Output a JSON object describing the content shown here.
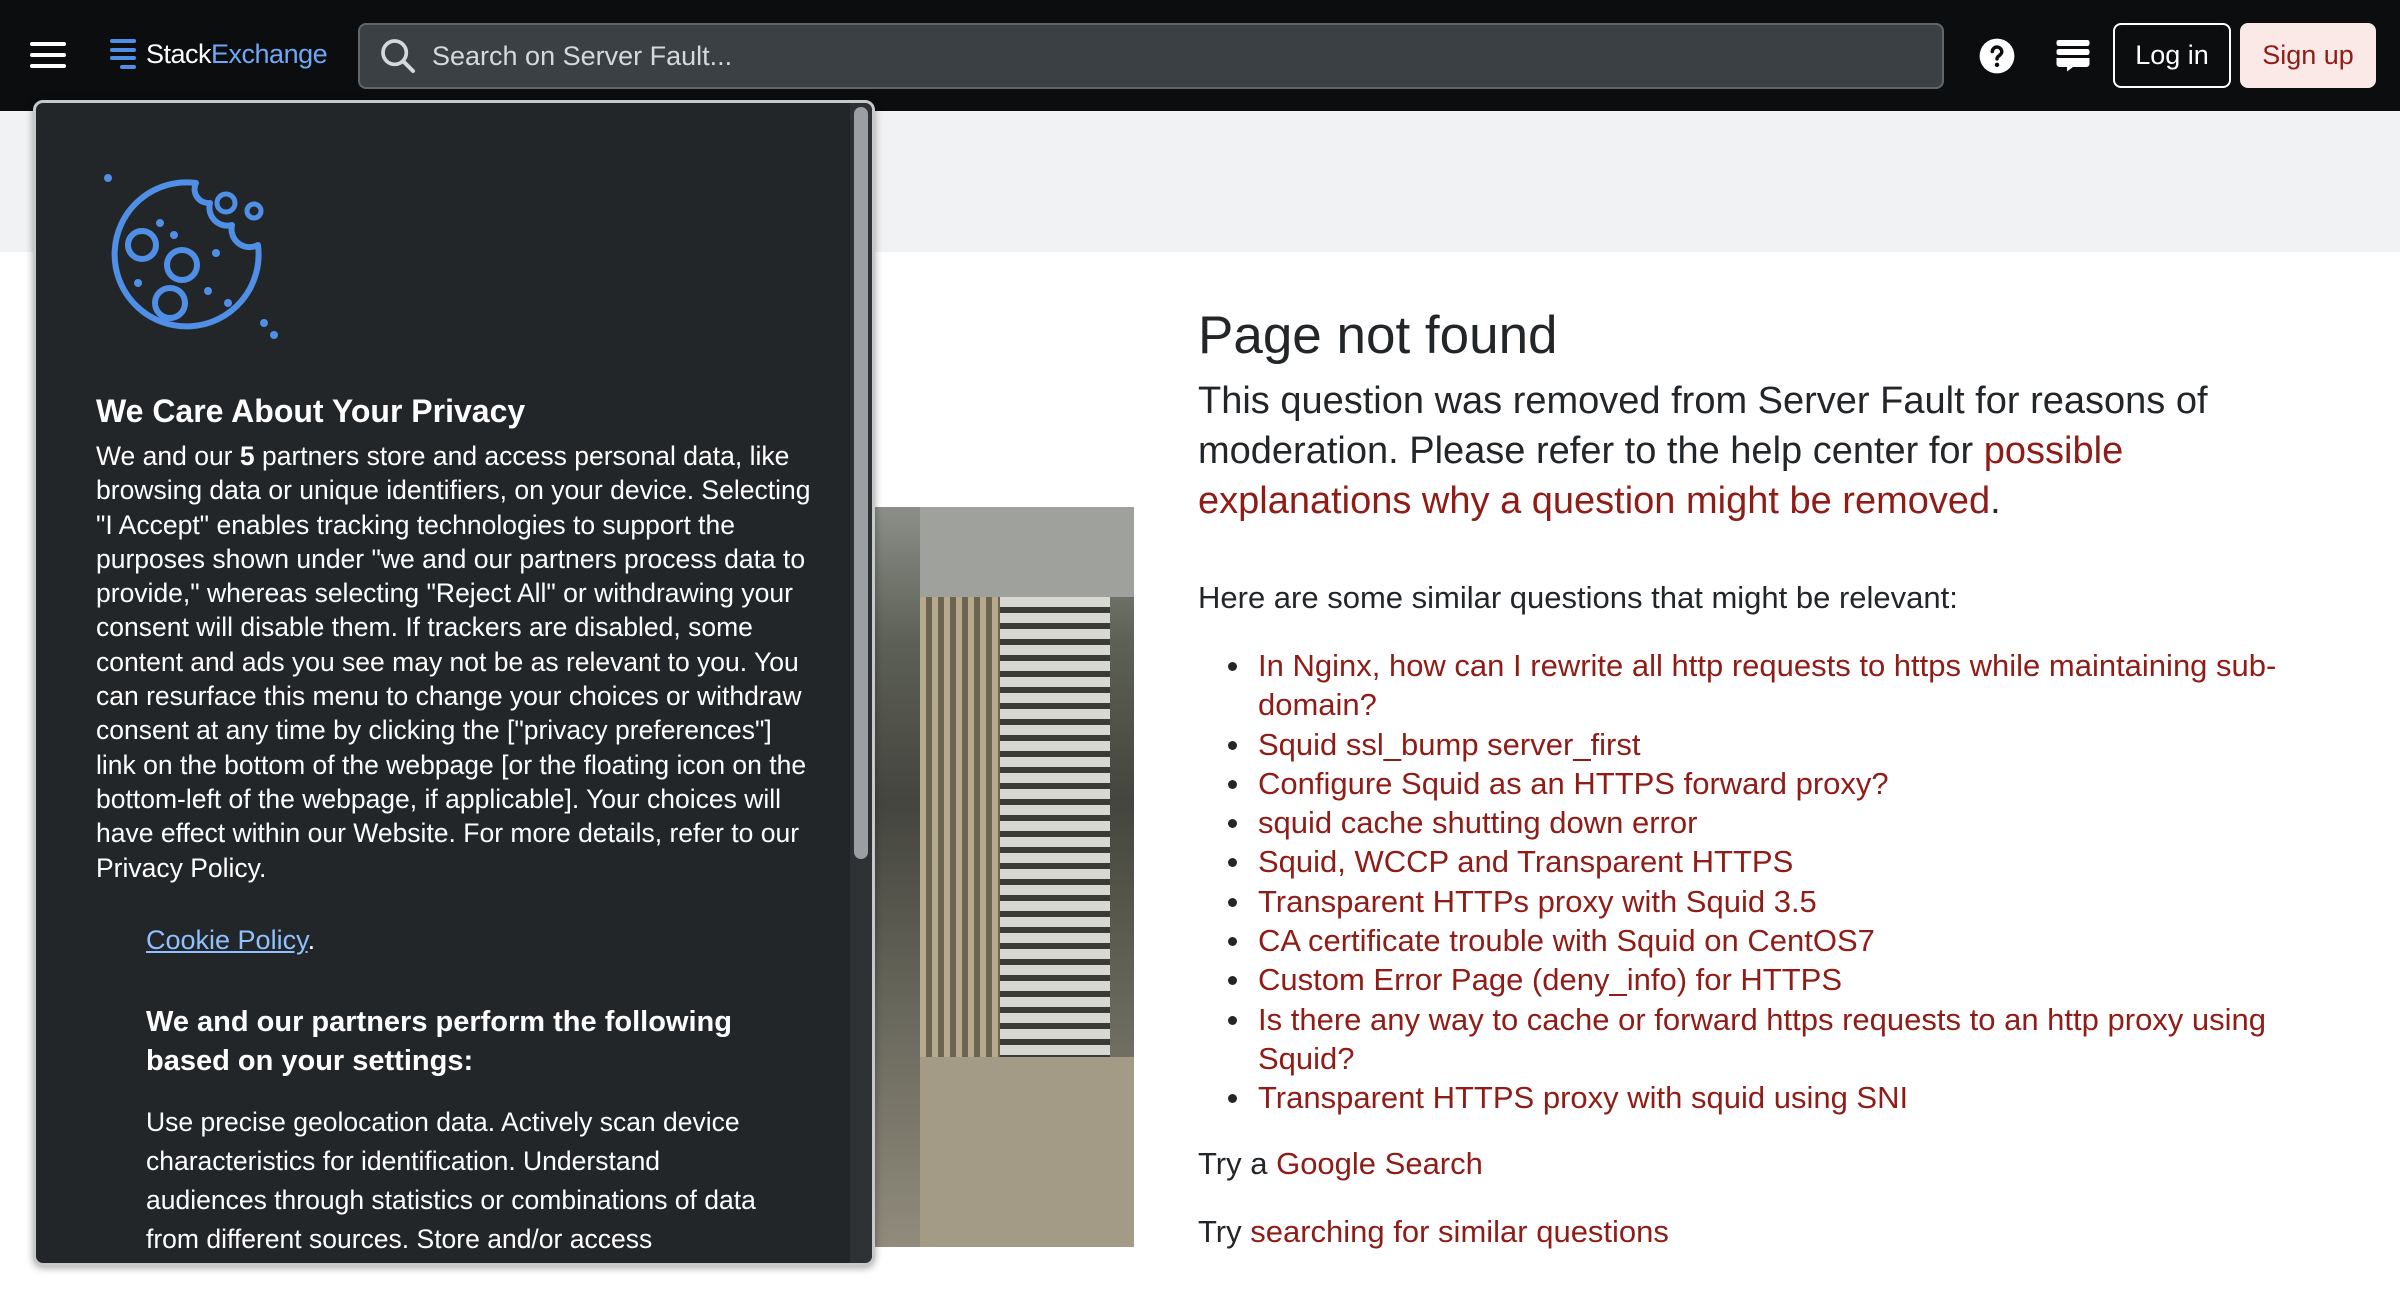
{
  "header": {
    "logo": {
      "part1": "Stack",
      "part2": "Exchange"
    },
    "search_placeholder": "Search on Server Fault...",
    "login_label": "Log in",
    "signup_label": "Sign up"
  },
  "privacy": {
    "title": "We Care About Your Privacy",
    "body_prefix": "We and our ",
    "partners_count": "5",
    "body_suffix": " partners store and access personal data, like browsing data or unique identifiers, on your device. Selecting \"I Accept\" enables tracking technologies to support the purposes shown under \"we and our partners process data to provide,\" whereas selecting \"Reject All\" or withdrawing your consent will disable them. If trackers are disabled, some content and ads you see may not be as relevant to you. You can resurface this menu to change your choices or withdraw consent at any time by clicking the [\"privacy preferences\"] link on the bottom of the webpage [or the floating icon on the bottom-left of the webpage, if applicable]. Your choices will have effect within our Website. For more details, refer to our Privacy Policy.",
    "cookie_policy_link": "Cookie Policy",
    "cookie_policy_suffix": ".",
    "settings_heading": "We and our partners perform the following based on your settings:",
    "purposes_text": "Use precise geolocation data. Actively scan device characteristics for identification. Understand audiences through statistics or combinations of data from different sources. Store and/or access"
  },
  "main": {
    "title": "Page not found",
    "lead_text": "This question was removed from Server Fault for reasons of moderation. Please refer to the help center for ",
    "lead_link": "possible explanations why a question might be removed",
    "lead_end": ".",
    "similar_intro": "Here are some similar questions that might be relevant:",
    "similar_questions": [
      "In Nginx, how can I rewrite all http requests to https while maintaining sub-domain?",
      "Squid ssl_bump server_first",
      "Configure Squid as an HTTPS forward proxy?",
      "squid cache shutting down error",
      "Squid, WCCP and Transparent HTTPS",
      "Transparent HTTPs proxy with Squid 3.5",
      "CA certificate trouble with Squid on CentOS7",
      "Custom Error Page (deny_info) for HTTPS",
      "Is there any way to cache or forward https requests to an http proxy using Squid?",
      "Transparent HTTPS proxy with squid using SNI"
    ],
    "try_google_prefix": "Try a ",
    "try_google_link": "Google Search",
    "try_similar_prefix": "Try ",
    "try_similar_link": "searching for similar questions"
  },
  "colors": {
    "topbar": "#0c0d0e",
    "link": "#8f1c16",
    "accent_blue": "#4f8fe6",
    "modal_bg": "#232629"
  },
  "icons": [
    "hamburger-menu-icon",
    "stackexchange-logo-icon",
    "search-icon",
    "help-icon",
    "inbox-icon",
    "cookie-icon"
  ]
}
